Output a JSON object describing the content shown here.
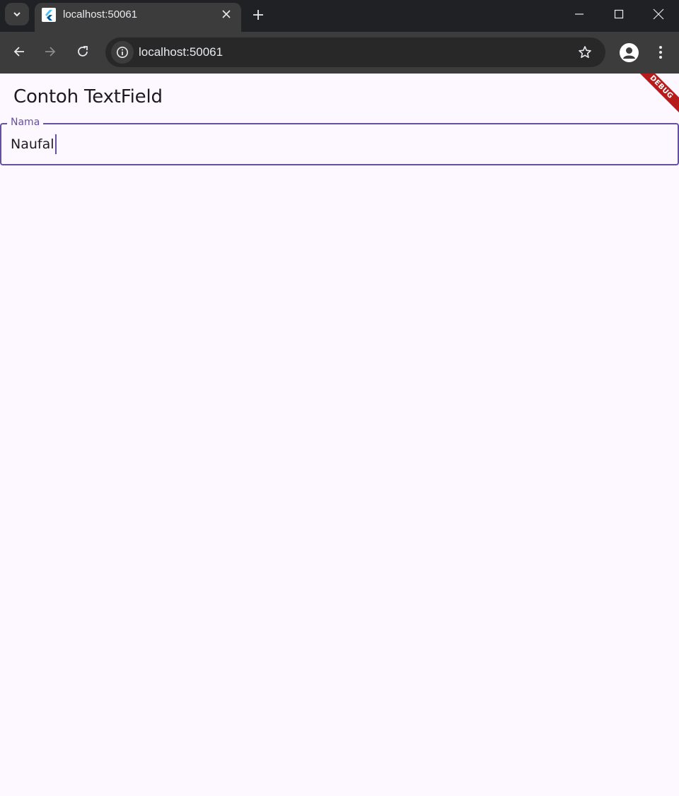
{
  "browser": {
    "tab": {
      "title": "localhost:50061"
    },
    "address_bar": {
      "url": "localhost:50061"
    }
  },
  "app": {
    "title": "Contoh TextField",
    "text_field": {
      "label": "Nama",
      "value": "Naufal"
    },
    "debug_banner": "DEBUG"
  },
  "colors": {
    "primary": "#6750a4",
    "background": "#fdf7ff",
    "debug_banner": "#b71c1c"
  }
}
